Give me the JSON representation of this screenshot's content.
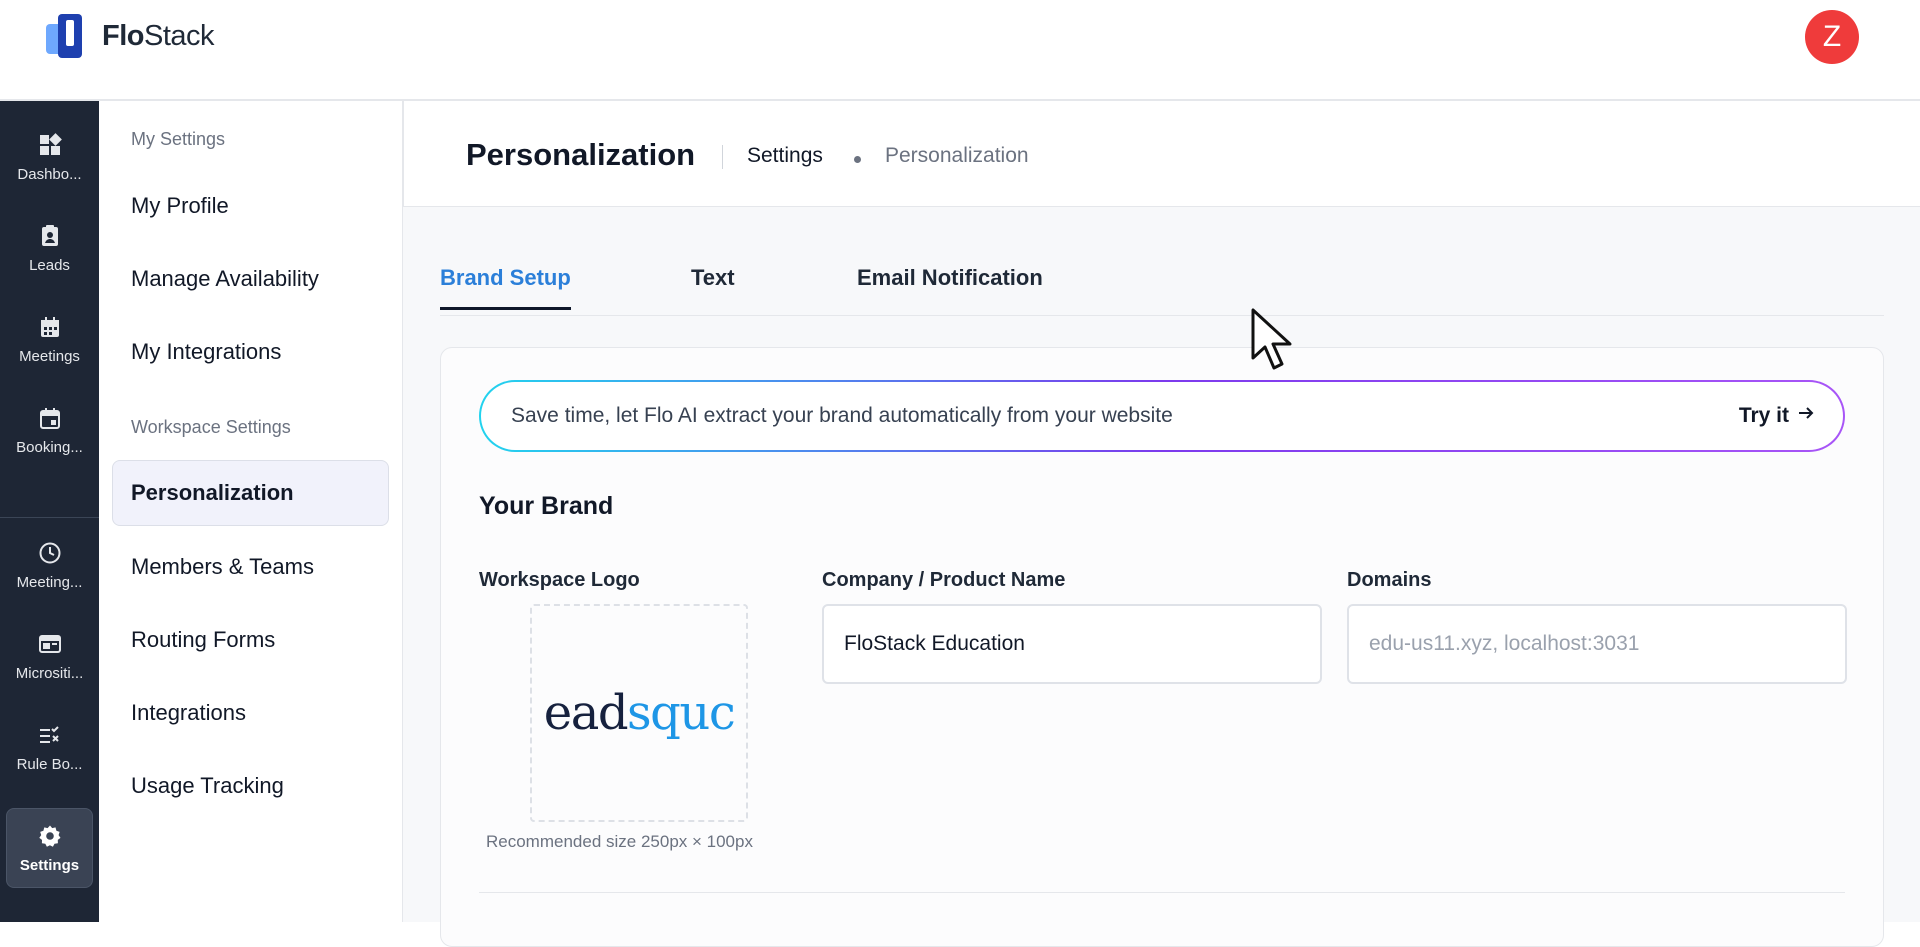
{
  "app": {
    "logo_text_bold": "Flo",
    "logo_text_light": "Stack",
    "avatar_initial": "Z"
  },
  "rail": [
    {
      "label": "Dashbo...",
      "icon": "dashboard-icon"
    },
    {
      "label": "Leads",
      "icon": "clipboard-user-icon"
    },
    {
      "label": "Meetings",
      "icon": "calendar-icon"
    },
    {
      "label": "Booking...",
      "icon": "calendar-event-icon"
    },
    {
      "label": "Meeting...",
      "icon": "clock-icon"
    },
    {
      "label": "Micrositi...",
      "icon": "browser-icon"
    },
    {
      "label": "Rule Bo...",
      "icon": "rules-icon"
    },
    {
      "label": "Settings",
      "icon": "gear-icon",
      "active": true
    }
  ],
  "subnav": {
    "my_settings_heading": "My Settings",
    "my_settings_items": [
      "My Profile",
      "Manage Availability",
      "My Integrations"
    ],
    "workspace_heading": "Workspace Settings",
    "workspace_items": [
      "Personalization",
      "Members & Teams",
      "Routing Forms",
      "Integrations",
      "Usage Tracking"
    ],
    "active": "Personalization"
  },
  "header": {
    "title": "Personalization",
    "breadcrumb": [
      "Settings",
      "Personalization"
    ]
  },
  "tabs": [
    {
      "label": "Brand Setup",
      "active": true
    },
    {
      "label": "Text",
      "active": false
    },
    {
      "label": "Email Notification",
      "active": false
    }
  ],
  "ai_banner": {
    "text": "Save time, let Flo AI extract your brand automatically from your website",
    "action": "Try it"
  },
  "brand": {
    "section_title": "Your Brand",
    "logo_label": "Workspace Logo",
    "logo_preview_dark": "ead",
    "logo_preview_blue": "squc",
    "logo_hint": "Recommended size 250px × 100px",
    "company_label": "Company / Product Name",
    "company_value": "FloStack Education",
    "domains_label": "Domains",
    "domains_placeholder": "edu-us11.xyz, localhost:3031"
  },
  "colors": {
    "accent": "#2b7fd9",
    "rail_bg": "#1e2635",
    "avatar": "#ef3b3b"
  }
}
